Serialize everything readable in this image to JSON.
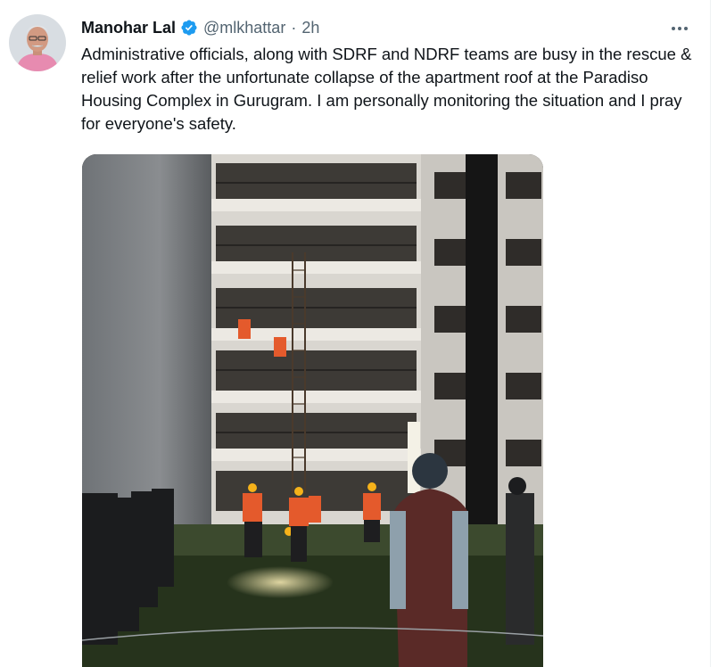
{
  "tweet": {
    "author_name": "Manohar Lal",
    "handle": "@mlkhattar",
    "separator": "·",
    "time": "2h",
    "verified": true,
    "text": "Administrative officials, along with SDRF and NDRF teams are busy in the rescue & relief work after the unfortunate collapse of the apartment roof at the Paradiso Housing Complex in Gurugram. I am personally monitoring the situation and I pray for everyone's safety.",
    "verified_color": "#1d9bf0",
    "icons": [
      "verified-badge-icon",
      "more-options-icon"
    ]
  }
}
